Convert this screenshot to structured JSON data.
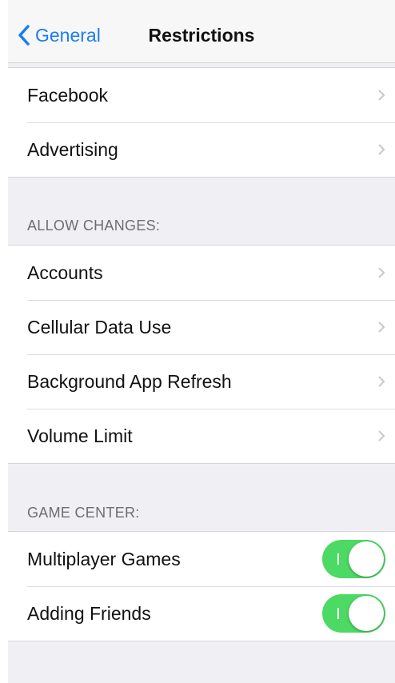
{
  "nav": {
    "back_label": "General",
    "title": "Restrictions"
  },
  "group_top": {
    "items": [
      {
        "label": "Facebook"
      },
      {
        "label": "Advertising"
      }
    ]
  },
  "allow_changes": {
    "header": "ALLOW CHANGES:",
    "items": [
      {
        "label": "Accounts"
      },
      {
        "label": "Cellular Data Use"
      },
      {
        "label": "Background App Refresh"
      },
      {
        "label": "Volume Limit"
      }
    ]
  },
  "game_center": {
    "header": "GAME CENTER:",
    "items": [
      {
        "label": "Multiplayer Games",
        "enabled": true
      },
      {
        "label": "Adding Friends",
        "enabled": true
      }
    ]
  },
  "colors": {
    "accent": "#1a7cf5",
    "toggle_on": "#4cd964",
    "background": "#efeff4"
  },
  "icons": {
    "back": "chevron-left-icon",
    "disclosure": "chevron-right-icon"
  }
}
